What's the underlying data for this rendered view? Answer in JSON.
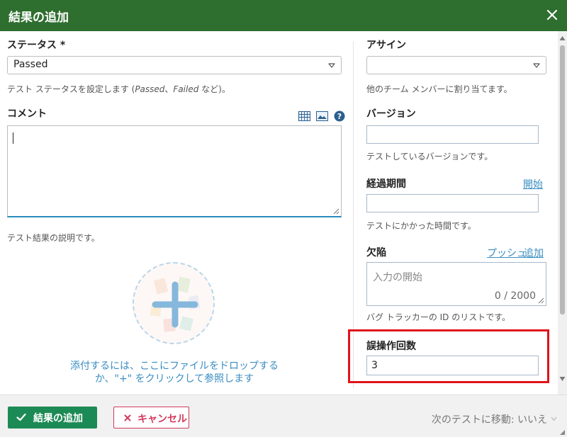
{
  "dialog": {
    "title": "結果の追加"
  },
  "status": {
    "label": "ステータス *",
    "value": "Passed",
    "help_prefix": "テスト ステータスを設定します (",
    "help_passed": "Passed",
    "help_sep": "、",
    "help_failed": "Failed",
    "help_suffix": " など)。"
  },
  "assign": {
    "label": "アサイン",
    "value": "",
    "help": "他のチーム メンバーに割り当てます。"
  },
  "comment": {
    "label": "コメント",
    "value": "",
    "help": "テスト結果の説明です。"
  },
  "version": {
    "label": "バージョン",
    "value": "",
    "help": "テストしているバージョンです。"
  },
  "elapsed": {
    "label": "経過期間",
    "start_link": "開始",
    "value": "",
    "help": "テストにかかった時間です。"
  },
  "defects": {
    "label": "欠陥",
    "push_link": "プッシュ",
    "add_link": "追加",
    "placeholder": "入力の開始",
    "counter": "0 / 2000",
    "help": "バグ トラッカーの ID のリストです。"
  },
  "attachments": {
    "drop_line1": "添付するには、ここにファイルをドロップする",
    "drop_line2": "か、\"+\" をクリックして参照します"
  },
  "misoperation": {
    "label": "誤操作回数",
    "value": "3"
  },
  "footer": {
    "submit_label": "結果の追加",
    "cancel_label": "キャンセル",
    "next_test": "次のテストに移動: いいえ"
  },
  "colors": {
    "header": "#2e6e2f",
    "primary": "#1c8a54",
    "cancel": "#d23a5c",
    "link": "#3a8dc1",
    "highlight": "#e0131b"
  }
}
